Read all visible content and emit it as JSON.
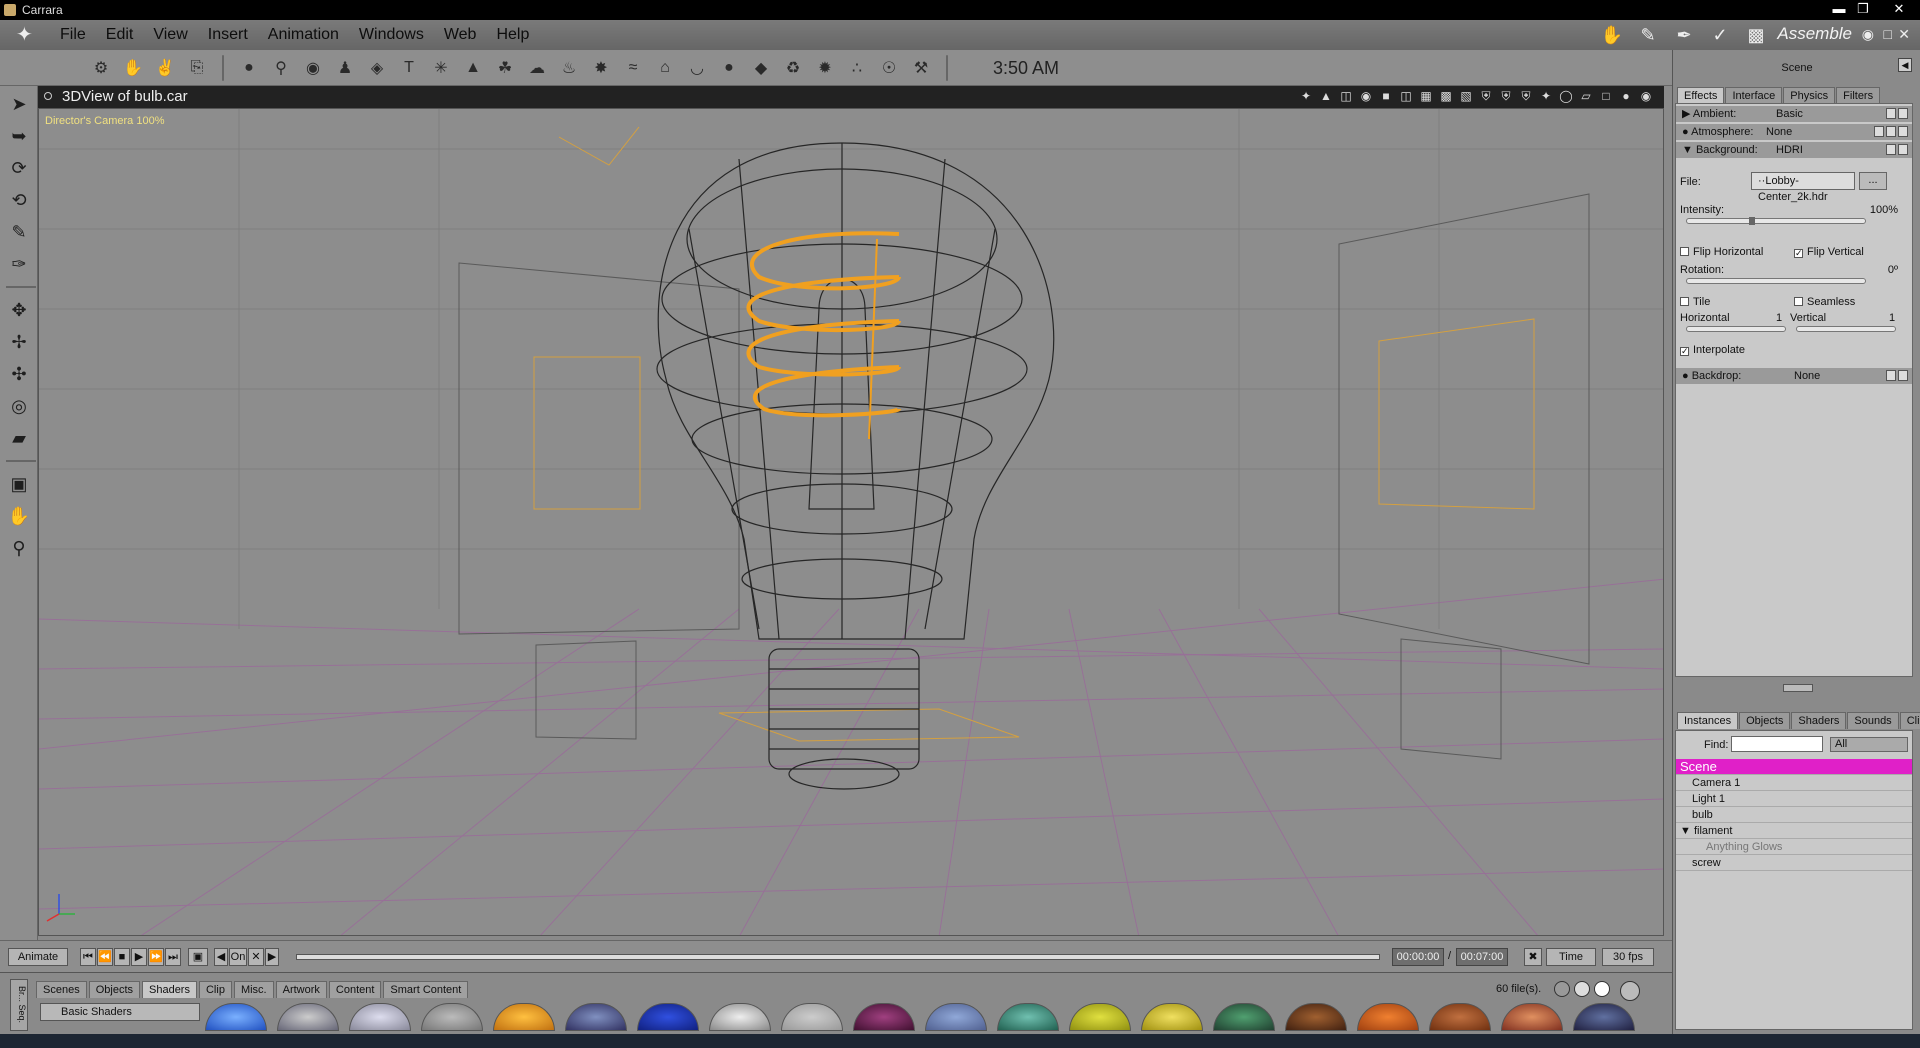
{
  "window": {
    "title": "Carrara"
  },
  "menu": [
    "File",
    "Edit",
    "View",
    "Insert",
    "Animation",
    "Windows",
    "Web",
    "Help"
  ],
  "room": {
    "label": "Assemble"
  },
  "toolbar": {
    "time": "3:50 AM"
  },
  "viewport": {
    "title": "3DView of bulb.car",
    "camera": "Director's Camera 100%"
  },
  "timeline": {
    "animate_label": "Animate",
    "on_label": "On",
    "current_time": "00:00:00",
    "end_time": "00:07:00",
    "time_mode": "Time",
    "fps": "30 fps"
  },
  "browser": {
    "tabs": [
      "Scenes",
      "Objects",
      "Shaders",
      "Clip",
      "Misc.",
      "Artwork",
      "Content",
      "Smart Content"
    ],
    "active_tab": "Shaders",
    "folder": "Basic Shaders",
    "file_count": "60 file(s).",
    "side_label": "Br... Seq."
  },
  "panel": {
    "header": "Scene",
    "tabs": [
      "Effects",
      "Interface",
      "Physics",
      "Filters"
    ],
    "ambient": {
      "label": "Ambient:",
      "value": "Basic"
    },
    "atmosphere": {
      "label": "Atmosphere:",
      "value": "None"
    },
    "background": {
      "label": "Background:",
      "value": "HDRI"
    },
    "file_label": "File:",
    "file_value": "··Lobby-Center_2k.hdr",
    "file_button": "...",
    "intensity_label": "Intensity:",
    "intensity_value": "100%",
    "intensity_level": 0.35,
    "flip_h": "Flip Horizontal",
    "flip_v": "Flip Vertical",
    "rotation_label": "Rotation:",
    "rotation_value": "0º",
    "tile": "Tile",
    "seamless": "Seamless",
    "horizontal_label": "Horizontal",
    "horizontal_value": "1",
    "vertical_label": "Vertical",
    "vertical_value": "1",
    "interpolate": "Interpolate",
    "backdrop": {
      "label": "Backdrop:",
      "value": "None"
    }
  },
  "instances": {
    "tabs": [
      "Instances",
      "Objects",
      "Shaders",
      "Sounds",
      "Clips"
    ],
    "find_label": "Find:",
    "find_filter": "All",
    "root": "Scene",
    "items": [
      "Camera 1",
      "Light 1",
      "bulb",
      "filament",
      "Anything Glows",
      "screw"
    ]
  },
  "colors": {
    "selection": "#e020c8",
    "filament": "#f0a020",
    "grid": "#9a5a9a",
    "frame": "#d4a040"
  }
}
